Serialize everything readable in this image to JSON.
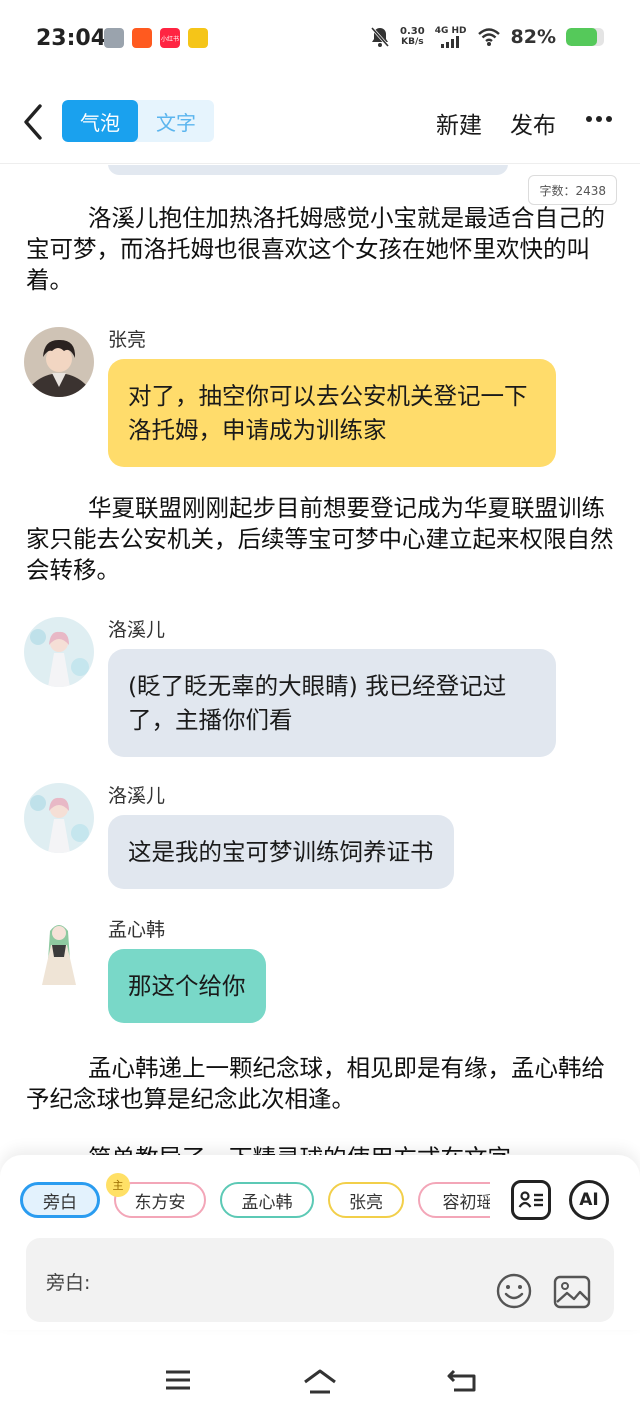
{
  "status_bar": {
    "time": "23:04",
    "apps": [
      {
        "name": "doc-app-icon",
        "color": "#9aa3ad",
        "label": ""
      },
      {
        "name": "taobao-app-icon",
        "color": "#ff5a1f",
        "label": ""
      },
      {
        "name": "xiaohongshu-app-icon",
        "color": "#ff2442",
        "label": "小红书"
      },
      {
        "name": "qqmusic-app-icon",
        "color": "#f5c518",
        "label": ""
      }
    ],
    "net_speed": "0.30",
    "net_speed_unit": "KB/s",
    "network": "4G HD",
    "battery_text": "82%",
    "battery_level": 0.82
  },
  "header": {
    "tabs": [
      {
        "label": "气泡",
        "active": true
      },
      {
        "label": "文字",
        "active": false
      }
    ],
    "new_label": "新建",
    "publish_label": "发布"
  },
  "content": {
    "word_count": "字数：2438",
    "items": [
      {
        "type": "narration",
        "text": "洛溪儿抱住加热洛托姆感觉小宝就是最适合自己的宝可梦，而洛托姆也很喜欢这个女孩在她怀里欢快的叫着。"
      },
      {
        "type": "message",
        "speaker": "张亮",
        "text": "对了，抽空你可以去公安机关登记一下洛托姆，申请成为训练家",
        "color": "yellow"
      },
      {
        "type": "narration",
        "text": "华夏联盟刚刚起步目前想要登记成为华夏联盟训练家只能去公安机关，后续等宝可梦中心建立起来权限自然会转移。"
      },
      {
        "type": "message",
        "speaker": "洛溪儿",
        "text": "(眨了眨无辜的大眼睛) 我已经登记过了，主播你们看",
        "color": "gray"
      },
      {
        "type": "message",
        "speaker": "洛溪儿",
        "text": "这是我的宝可梦训练饲养证书",
        "color": "gray"
      },
      {
        "type": "message",
        "speaker": "孟心韩",
        "text": "那这个给你",
        "color": "teal"
      },
      {
        "type": "narration",
        "text": "孟心韩递上一颗纪念球，相见即是有缘，孟心韩给予纪念球也算是纪念此次相逢。"
      },
      {
        "type": "narration",
        "text": "简单教导了一下精灵球的使用方式在文字"
      }
    ]
  },
  "bottom": {
    "chips": [
      {
        "label": "旁白",
        "color": "#2a9cf0",
        "selected": true
      },
      {
        "label": "东方安",
        "color": "#f3a6b8",
        "selected": false
      },
      {
        "label": "孟心韩",
        "color": "#5cc9b5",
        "selected": false
      },
      {
        "label": "张亮",
        "color": "#f2cf4a",
        "selected": false
      },
      {
        "label": "容初瑶",
        "color": "#f3a6b8",
        "selected": false
      }
    ],
    "protagonist_badge": "主",
    "ai_label": "AI",
    "input_label": "旁白:"
  }
}
